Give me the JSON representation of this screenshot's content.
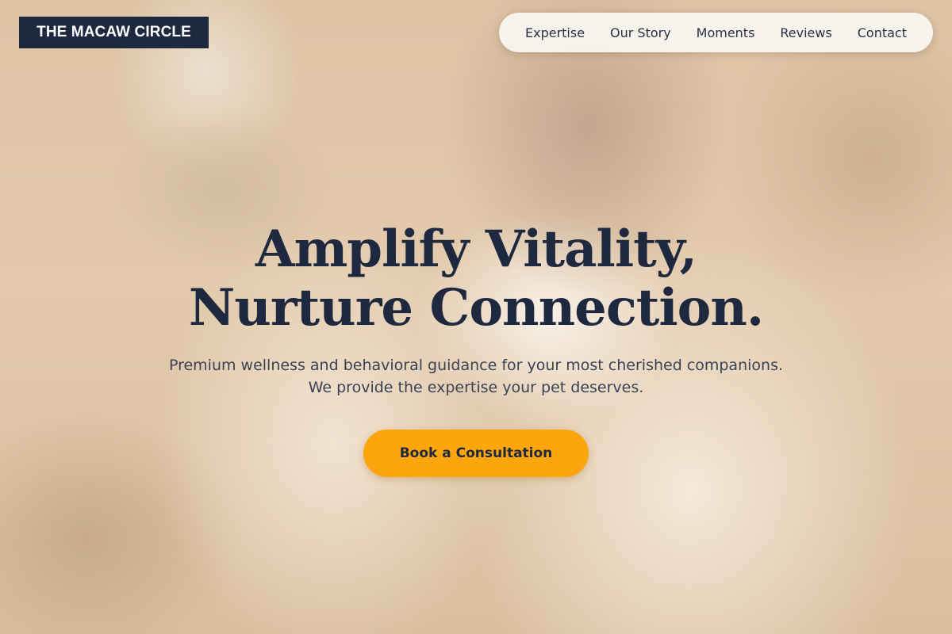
{
  "brand": {
    "logo_text": "THE MACAW CIRCLE"
  },
  "nav": {
    "items": [
      {
        "label": "Expertise"
      },
      {
        "label": "Our Story"
      },
      {
        "label": "Moments"
      },
      {
        "label": "Reviews"
      },
      {
        "label": "Contact"
      }
    ]
  },
  "hero": {
    "headline_line1": "Amplify Vitality,",
    "headline_line2": "Nurture Connection.",
    "subtitle_line1": "Premium wellness and behavioral guidance for your most cherished companions.",
    "subtitle_line2": "We provide the expertise your pet deserves.",
    "cta_label": "Book a Consultation"
  },
  "colors": {
    "brand_navy": "#1e2940",
    "cta_orange": "#fca60b",
    "nav_pill": "#fcfbf9"
  }
}
